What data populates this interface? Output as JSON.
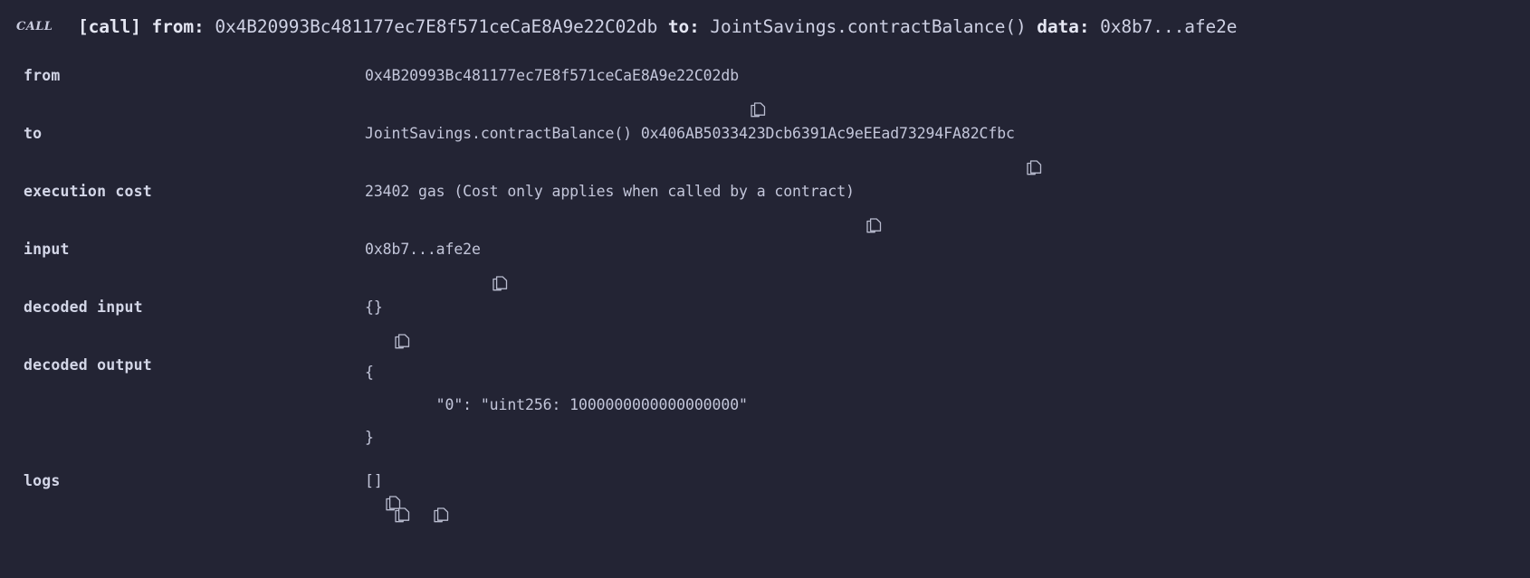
{
  "header": {
    "badge": "CALL",
    "prefix": "[call]",
    "from_key": "from:",
    "from_value": "0x4B20993Bc481177ec7E8f571ceCaE8A9e22C02db",
    "to_key": "to:",
    "to_value": "JointSavings.contractBalance()",
    "data_key": "data:",
    "data_value": "0x8b7...afe2e"
  },
  "colors": {
    "background": "#232434",
    "text": "#c3c6da",
    "label": "#d3d6e7",
    "icon": "#b9bccf"
  },
  "rows": [
    {
      "label": "from",
      "value": "0x4B20993Bc481177ec7E8f571ceCaE8A9e22C02db",
      "copy_icon": "copy-icon"
    },
    {
      "label": "to",
      "value": "JointSavings.contractBalance() 0x406AB5033423Dcb6391Ac9eEEad73294FA82Cfbc",
      "copy_icon": "copy-icon"
    },
    {
      "label": "execution cost",
      "value": "23402 gas (Cost only applies when called by a contract)",
      "copy_icon": "copy-icon"
    },
    {
      "label": "input",
      "value": "0x8b7...afe2e",
      "copy_icon": "copy-icon"
    },
    {
      "label": "decoded input",
      "value": "{}",
      "copy_icon": "copy-icon"
    }
  ],
  "decoded_output": {
    "label": "decoded output",
    "line_open": "{",
    "line_value": "        \"0\": \"uint256: 1000000000000000000\"",
    "line_close": "}",
    "copy_icon": "copy-icon"
  },
  "logs": {
    "label": "logs",
    "value": "[]",
    "copy_icon_1": "copy-icon",
    "copy_icon_2": "copy-icon"
  }
}
